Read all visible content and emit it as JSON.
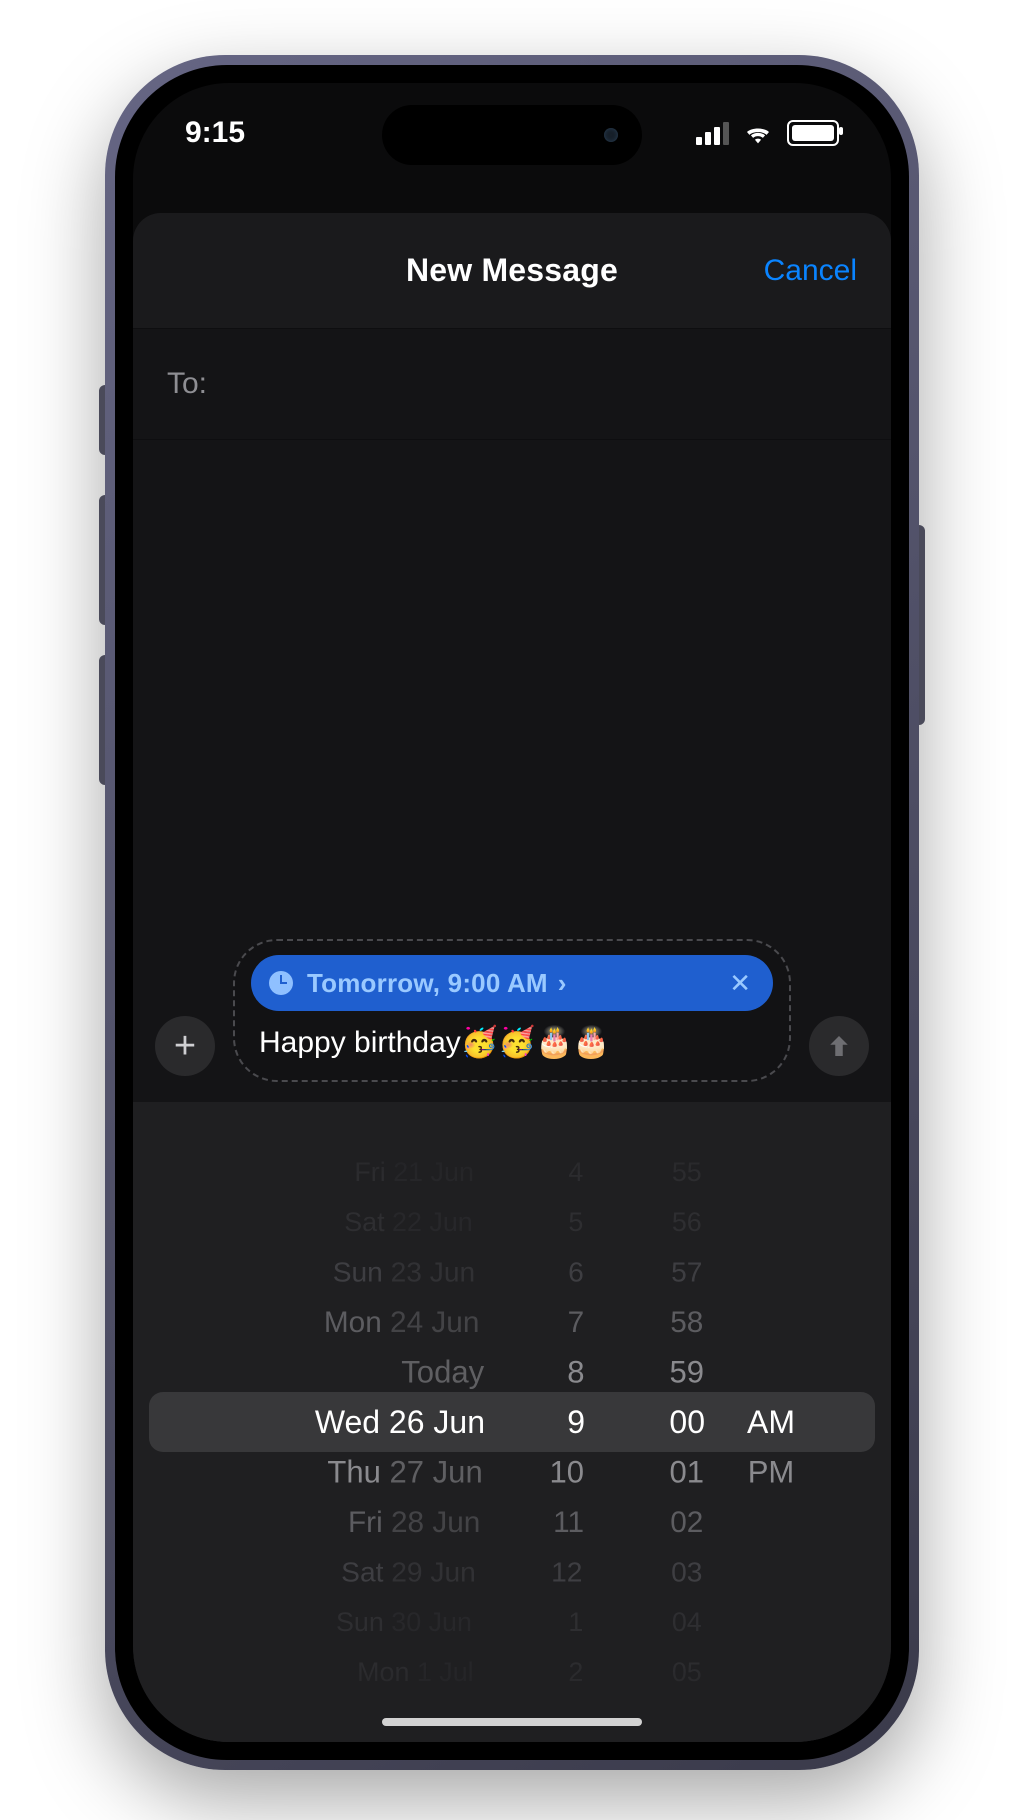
{
  "status": {
    "time": "9:15"
  },
  "header": {
    "title": "New Message",
    "cancel": "Cancel"
  },
  "compose": {
    "to_label": "To:",
    "schedule_label": "Tomorrow, 9:00 AM",
    "message_text": "Happy birthday🥳🥳🎂🎂"
  },
  "picker": {
    "dates": [
      {
        "dow": "Fri",
        "rest": "21 Jun"
      },
      {
        "dow": "Sat",
        "rest": "22 Jun"
      },
      {
        "dow": "Sun",
        "rest": "23 Jun"
      },
      {
        "dow": "Mon",
        "rest": "24 Jun"
      },
      {
        "dow": "",
        "rest": "Today"
      },
      {
        "dow": "Wed",
        "rest": "26 Jun"
      },
      {
        "dow": "Thu",
        "rest": "27 Jun"
      },
      {
        "dow": "Fri",
        "rest": "28 Jun"
      },
      {
        "dow": "Sat",
        "rest": "29 Jun"
      },
      {
        "dow": "Sun",
        "rest": "30 Jun"
      },
      {
        "dow": "Mon",
        "rest": "1 Jul"
      }
    ],
    "hours": [
      "4",
      "5",
      "6",
      "7",
      "8",
      "9",
      "10",
      "11",
      "12",
      "1",
      "2"
    ],
    "minutes": [
      "55",
      "56",
      "57",
      "58",
      "59",
      "00",
      "01",
      "02",
      "03",
      "04",
      "05"
    ],
    "ampm": [
      "AM",
      "PM"
    ],
    "selected_index": 5
  }
}
